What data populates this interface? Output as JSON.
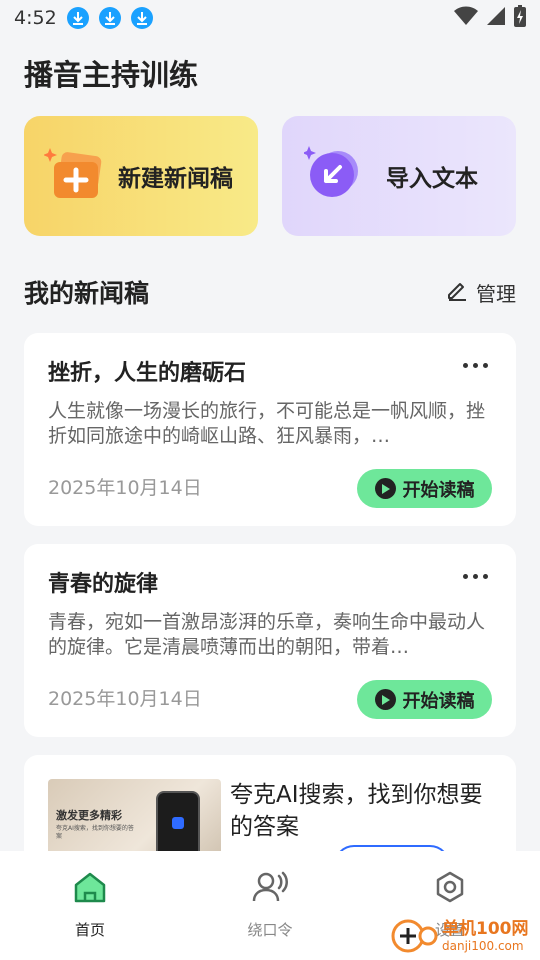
{
  "status_bar": {
    "time": "4:52",
    "icons": [
      "download-icon",
      "download-icon",
      "download-icon",
      "wifi-icon",
      "signal-icon",
      "battery-charging-icon"
    ]
  },
  "page": {
    "title": "播音主持训练"
  },
  "actions": {
    "new_draft": "新建新闻稿",
    "import_text": "导入文本"
  },
  "section": {
    "title": "我的新闻稿",
    "manage": "管理"
  },
  "drafts": [
    {
      "title": "挫折，人生的磨砺石",
      "excerpt": "人生就像一场漫长的旅行，不可能总是一帆风顺，挫折如同旅途中的崎岖山路、狂风暴雨，…",
      "date": "2025年10月14日",
      "action": "开始读稿"
    },
    {
      "title": "青春的旋律",
      "excerpt": "青春，宛如一首激昂澎湃的乐章，奏响生命中最动人的旋律。它是清晨喷薄而出的朝阳，带着…",
      "date": "2025年10月14日",
      "action": "开始读稿"
    }
  ],
  "ad": {
    "text": "夸克AI搜索，找到你想要的答案",
    "image_caption": "激发更多精彩",
    "image_subcaption": "夸克AI搜索，找到你想要的答案"
  },
  "nav": [
    {
      "label": "首页",
      "icon": "home-icon",
      "active": true
    },
    {
      "label": "绕口令",
      "icon": "speaker-person-icon",
      "active": false
    },
    {
      "label": "设置",
      "icon": "settings-hexagon-icon",
      "active": false
    }
  ],
  "watermark": {
    "text": "单机100网",
    "url": "danji100.com"
  },
  "colors": {
    "accent_green": "#6ee79a",
    "new_card": "#f7d468",
    "import_card": "#e0d6fb",
    "active_nav": "#1e8a4c"
  }
}
